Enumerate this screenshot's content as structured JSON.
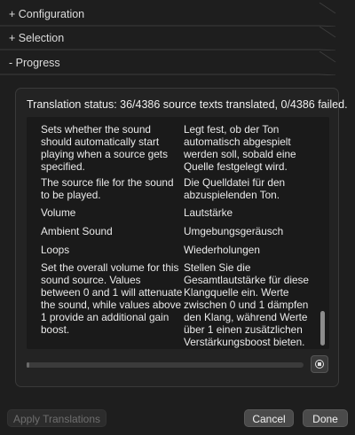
{
  "sections": {
    "configuration": "+ Configuration",
    "selection": "+ Selection",
    "progress": "- Progress"
  },
  "status_text": "Translation status: 36/4386 source texts translated, 0/4386 failed.",
  "translations": [
    {
      "source": "Sets whether the sound should automatically start playing when a source gets specified.",
      "target": "Legt fest, ob der Ton automatisch abgespielt werden soll, sobald eine Quelle festgelegt wird."
    },
    {
      "source": "The source file for the sound to be played.",
      "target": "Die Quelldatei für den abzuspielenden Ton."
    },
    {
      "source": "Volume",
      "target": "Lautstärke"
    },
    {
      "source": "Ambient Sound",
      "target": "Umgebungsgeräusch"
    },
    {
      "source": "Loops",
      "target": "Wiederholungen"
    },
    {
      "source": "Set the overall volume for this sound source. Values between 0 and 1 will attenuate the sound, while values above 1 provide an additional gain boost.",
      "target": "Stellen Sie die Gesamtlautstärke für diese Klangquelle ein. Werte zwischen 0 und 1 dämpfen den Klang, während Werte über 1 einen zusätzlichen Verstärkungsboost bieten."
    }
  ],
  "progress_fraction": 0.0082,
  "icons": {
    "stop": "stop-circle-icon"
  },
  "buttons": {
    "apply": "Apply Translations",
    "cancel": "Cancel",
    "done": "Done"
  }
}
